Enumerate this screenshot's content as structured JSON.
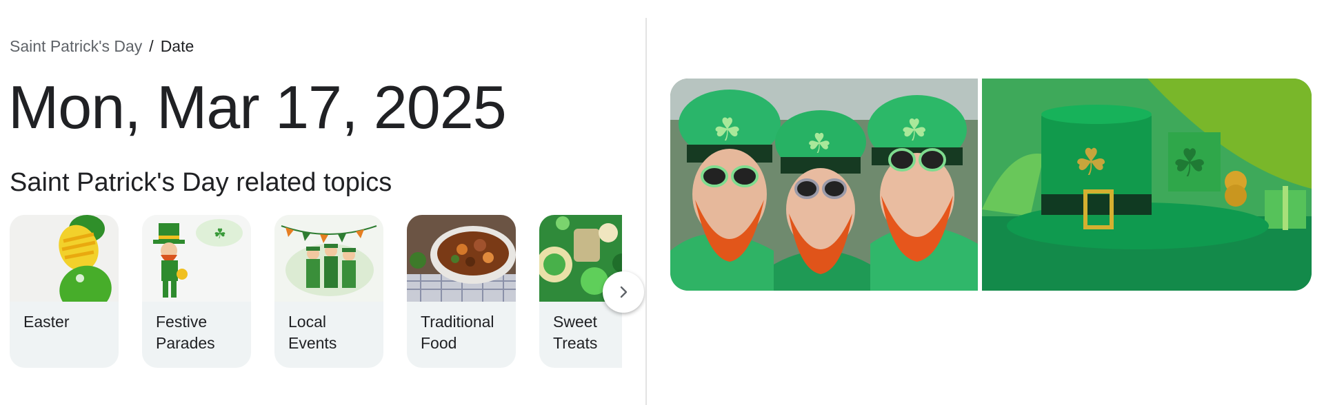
{
  "breadcrumb": {
    "parent": "Saint Patrick's Day",
    "separator": "/",
    "current": "Date"
  },
  "date_title": "Mon, Mar 17, 2025",
  "topics_heading": "Saint Patrick's Day related topics",
  "topics": [
    {
      "label": "Easter"
    },
    {
      "label": "Festive Parades"
    },
    {
      "label": "Local Events"
    },
    {
      "label": "Traditional Food"
    },
    {
      "label": "Sweet Treats"
    }
  ],
  "icons": {
    "next": "chevron-right-icon"
  },
  "colors": {
    "accent_green": "#1faa59",
    "card_bg": "#eff3f4",
    "divider": "#e3e3e3"
  }
}
